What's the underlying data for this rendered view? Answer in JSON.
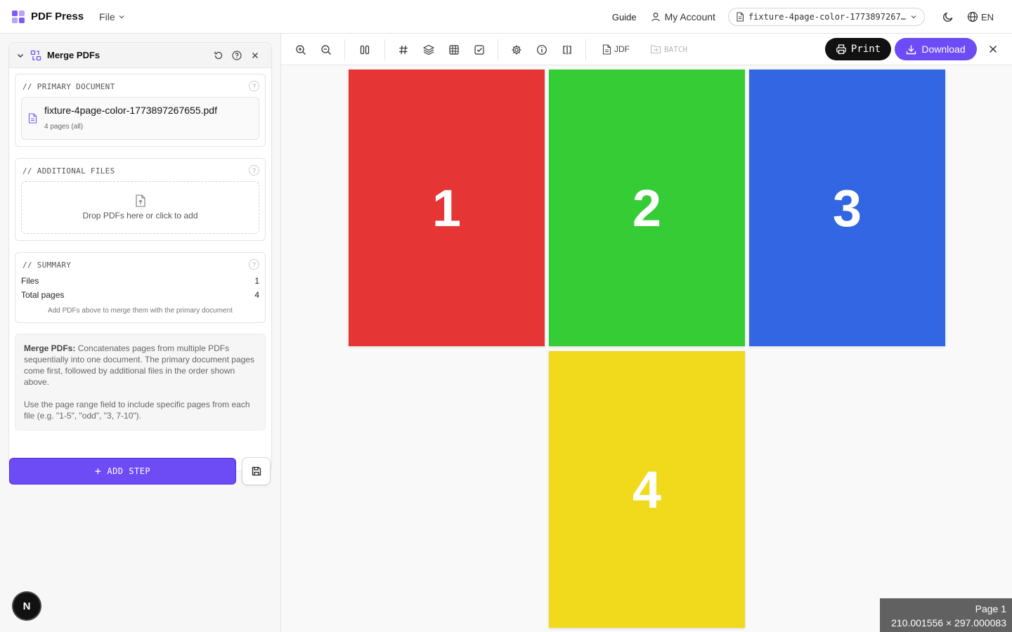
{
  "app": {
    "name": "PDF Press",
    "file_menu": "File"
  },
  "header": {
    "guide": "Guide",
    "account": "My Account",
    "document": "fixture-4page-color-1773897267655.pdf",
    "language": "EN"
  },
  "step": {
    "title": "Merge PDFs",
    "primary": {
      "title": "// PRIMARY DOCUMENT",
      "file_name": "fixture-4page-color-1773897267655.pdf",
      "pages": "4 pages (all)"
    },
    "additional": {
      "title": "// ADDITIONAL FILES",
      "drop_text": "Drop PDFs here or click to add"
    },
    "summary": {
      "title": "// SUMMARY",
      "files_label": "Files",
      "files_value": "1",
      "pages_label": "Total pages",
      "pages_value": "4",
      "note": "Add PDFs above to merge them with the primary document"
    },
    "description": {
      "bold": "Merge PDFs:",
      "text": " Concatenates pages from multiple PDFs sequentially into one document. The primary document pages come first, followed by additional files in the order shown above.",
      "tip": "Use the page range field to include specific pages from each file (e.g. \"1-5\", \"odd\", \"3, 7-10\")."
    },
    "help_glyph": "?"
  },
  "actions": {
    "add_step": "ADD STEP"
  },
  "badge": "N",
  "toolbar": {
    "jdf": "JDF",
    "batch": "BATCH",
    "print": "Print",
    "download": "Download"
  },
  "pages": [
    {
      "number": "1",
      "color": "#e53535"
    },
    {
      "number": "2",
      "color": "#35cc35"
    },
    {
      "number": "3",
      "color": "#3366e3"
    },
    {
      "number": "4",
      "color": "#f1d91b"
    }
  ],
  "page_info": {
    "label": "Page 1",
    "size": "210.001556 × 297.000083"
  },
  "colors": {
    "accent": "#6d4cf6",
    "logo": [
      "#7b5cf5",
      "#b7a4fb",
      "#b7a4fb",
      "#7b5cf5"
    ]
  },
  "icons": [
    "apps-icon",
    "chevron-down-icon",
    "user-icon",
    "file-icon",
    "moon-icon",
    "globe-icon",
    "merge-icon",
    "reset-icon",
    "help-icon",
    "close-icon",
    "upload-icon",
    "save-icon",
    "zoom-in-icon",
    "zoom-out-icon",
    "columns-icon",
    "hash-icon",
    "layers-icon",
    "grid-icon",
    "checkbox-icon",
    "settings-icon",
    "info-icon",
    "compare-icon",
    "batch-icon",
    "printer-icon",
    "download-icon"
  ]
}
